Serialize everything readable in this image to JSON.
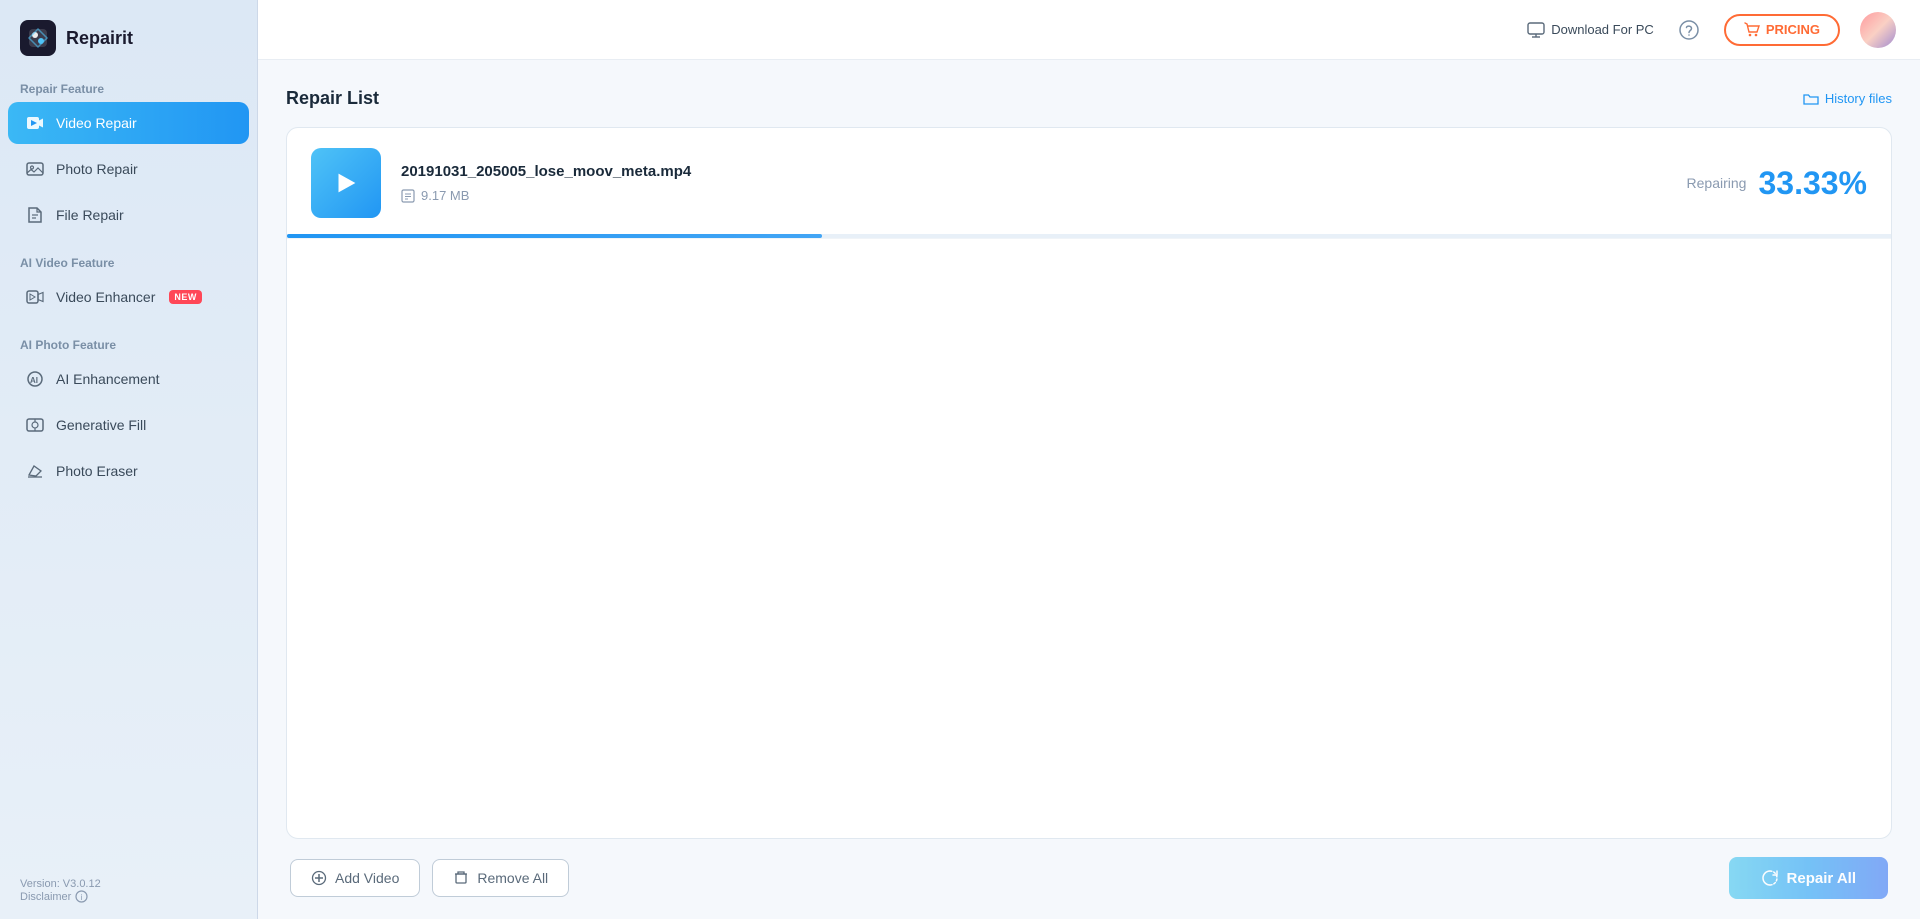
{
  "app": {
    "name": "Repairit"
  },
  "sidebar": {
    "repair_feature_label": "Repair Feature",
    "items": [
      {
        "id": "video-repair",
        "label": "Video Repair",
        "active": true
      },
      {
        "id": "photo-repair",
        "label": "Photo Repair",
        "active": false
      },
      {
        "id": "file-repair",
        "label": "File Repair",
        "active": false
      }
    ],
    "ai_video_label": "AI Video Feature",
    "ai_video_items": [
      {
        "id": "video-enhancer",
        "label": "Video Enhancer",
        "badge": "NEW"
      }
    ],
    "ai_photo_label": "AI Photo Feature",
    "ai_photo_items": [
      {
        "id": "ai-enhancement",
        "label": "AI Enhancement",
        "badge": null
      },
      {
        "id": "generative-fill",
        "label": "Generative Fill",
        "badge": null
      },
      {
        "id": "photo-eraser",
        "label": "Photo Eraser",
        "badge": null
      }
    ],
    "version": "Version: V3.0.12",
    "disclaimer": "Disclaimer"
  },
  "header": {
    "download_label": "Download For PC",
    "pricing_label": "PRICING"
  },
  "main": {
    "title": "Repair List",
    "history_files_label": "History files",
    "file": {
      "name": "20191031_205005_lose_moov_meta.mp4",
      "size": "9.17 MB",
      "status": "Repairing",
      "progress_percent": "33.33%",
      "progress_value": 33.33
    },
    "toolbar": {
      "add_video": "Add Video",
      "remove_all": "Remove All",
      "repair_all": "Repair All"
    }
  },
  "colors": {
    "accent": "#2196f3",
    "pricing_orange": "#ff6b35",
    "active_bg_start": "#3bb8f5",
    "active_bg_end": "#2196f3"
  }
}
